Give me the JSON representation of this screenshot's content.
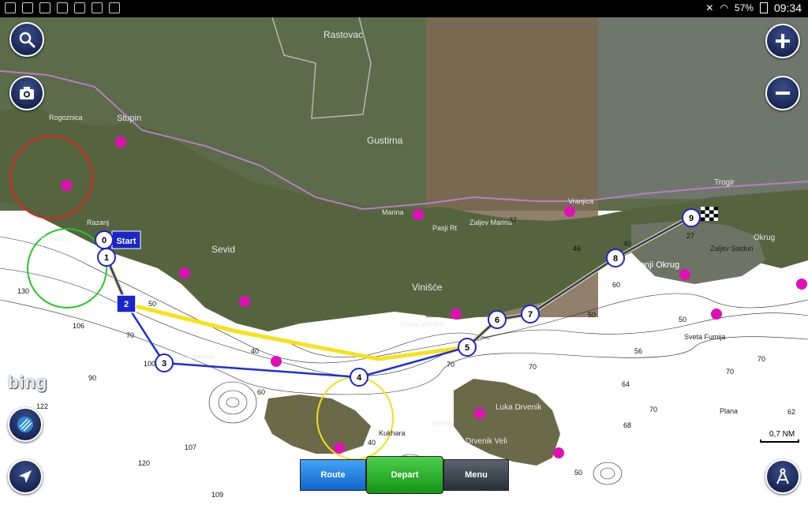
{
  "status_bar": {
    "battery": "57%",
    "time": "09:34"
  },
  "controls": {
    "search": "search-icon",
    "camera": "camera-icon",
    "zoom_in": "plus-icon",
    "zoom_out": "minus-icon",
    "layers": "layers-icon",
    "locate": "navigation-arrow-icon",
    "compass": "divider-compass-icon"
  },
  "bottom_bar": {
    "route": "Route",
    "depart": "Depart",
    "menu": "Menu"
  },
  "scale": "0,7 NM",
  "brand": "bing",
  "route_start_label": "Start",
  "waypoints": [
    "0",
    "1",
    "2",
    "3",
    "4",
    "5",
    "6",
    "7",
    "8",
    "9"
  ],
  "place_names": {
    "rastovac": "Rastovac",
    "gustirna": "Gustirna",
    "sevid": "Sevid",
    "vinisce": "Vinišće",
    "stupin": "Stupin",
    "rogoznica": "Rogoznica",
    "razanj": "Razanj",
    "rt_foun": "Rt Foun...",
    "trogir": "Trogir",
    "donji_okrug": "Donji Okrug",
    "zaljev_saldun": "Zaljev Saldun",
    "sveta_fumija": "Sveta Fumija",
    "luka_drvenik": "Luka Drvenik",
    "drvenik_veli": "Drvenik Veli",
    "arkandel": "Arkandel",
    "zaljev_marina": "Zaljev Marina",
    "marina": "Marina",
    "pasji_rt": "Pasji Rt",
    "uvala_vinisce": "Uvala Vinišće",
    "uvala_stupin": "Uvala Stupin",
    "kukhara": "Kukhara",
    "rt_hibi": "Rt Hibi",
    "plana": "Plana",
    "vranjica": "Vranjica",
    "okrug": "Okrug"
  },
  "depths": [
    "130",
    "106",
    "70",
    "100",
    "90",
    "122",
    "107",
    "120",
    "109",
    "60",
    "40",
    "50",
    "70",
    "70",
    "64",
    "68",
    "70",
    "56",
    "60",
    "40",
    "37",
    "46",
    "50",
    "50",
    "70",
    "62",
    "70",
    "50",
    "40",
    "27"
  ],
  "colors": {
    "route_blue": "#1d2fd8",
    "planned_yellow": "#f6e21a",
    "status_bg": "#000000",
    "button_navy": "#0b1640",
    "route_green": "#139313"
  }
}
